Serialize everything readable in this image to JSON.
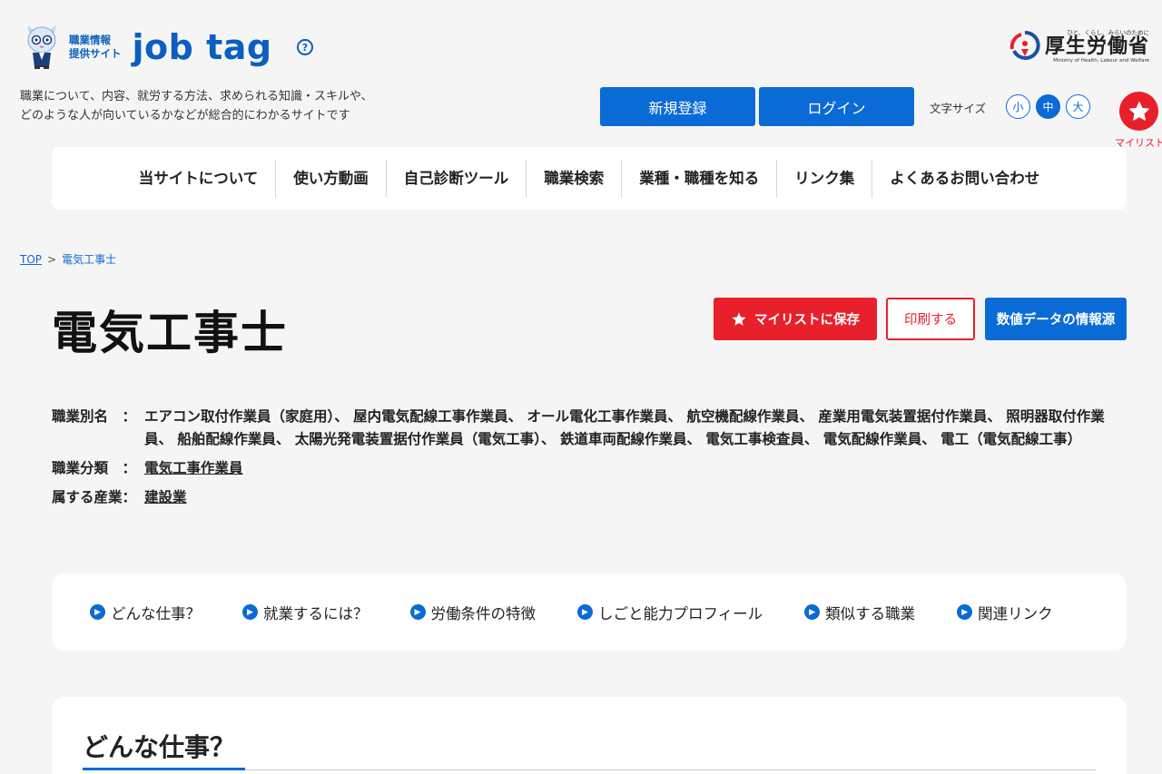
{
  "header": {
    "logo_sub_line1": "職業情報",
    "logo_sub_line2": "提供サイト",
    "logo_main": "job tag",
    "help_symbol": "?",
    "ministry_tagline": "ひと、くらし、みらいのために",
    "ministry_name": "厚生労働省",
    "ministry_en": "Ministry of Health, Labour and Welfare",
    "tagline_line1": "職業について、内容、就労する方法、求められる知識・スキルや、",
    "tagline_line2": "どのような人が向いているかなどが総合的にわかるサイトです",
    "register_label": "新規登録",
    "login_label": "ログイン",
    "fontsize_label": "文字サイズ",
    "fontsize_small": "小",
    "fontsize_mid": "中",
    "fontsize_large": "大",
    "mylist_label": "マイリスト"
  },
  "nav": {
    "items": [
      "当サイトについて",
      "使い方動画",
      "自己診断ツール",
      "職業検索",
      "業種・職種を知る",
      "リンク集",
      "よくあるお問い合わせ"
    ]
  },
  "breadcrumb": {
    "top": "TOP",
    "sep": ">",
    "current": "電気工事士"
  },
  "page": {
    "title": "電気工事士",
    "save_label": "マイリストに保存",
    "print_label": "印刷する",
    "data_label": "数値データの情報源"
  },
  "info": {
    "alias_label": "職業別名　：",
    "alias_value": "エアコン取付作業員（家庭用）、 屋内電気配線工事作業員、 オール電化工事作業員、 航空機配線作業員、 産業用電気装置据付作業員、 照明器取付作業員、 船舶配線作業員、 太陽光発電装置据付作業員（電気工事）、 鉄道車両配線作業員、 電気工事検査員、 電気配線作業員、 電工（電気配線工事）",
    "category_label": "職業分類　：",
    "category_value": "電気工事作業員",
    "industry_label": "属する産業：",
    "industry_value": "建設業"
  },
  "anchors": [
    "どんな仕事？",
    "就業するには？",
    "労働条件の特徴",
    "しごと能力プロフィール",
    "類似する職業",
    "関連リンク"
  ],
  "section": {
    "title": "どんな仕事？"
  },
  "colors": {
    "primary_blue": "#0b6bd6",
    "accent_red": "#e8202c",
    "background": "#f5f5f5"
  },
  "icons": {
    "help": "question-circle-icon",
    "mylist": "star-icon",
    "anchor": "chevron-right-circle-icon"
  }
}
